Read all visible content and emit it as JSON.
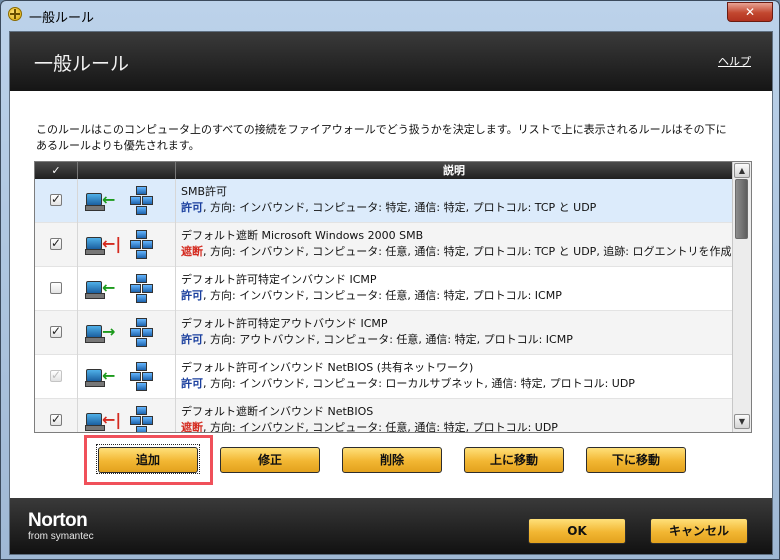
{
  "window": {
    "title": "一般ルール",
    "close_label": "✕"
  },
  "header": {
    "title": "一般ルール",
    "help_link": "ヘルプ"
  },
  "description": "このルールはこのコンピュータ上のすべての接続をファイアウォールでどう扱うかを決定します。リストで上に表示されるルールはその下にあるルールよりも優先されます。",
  "table": {
    "columns": {
      "check": "✓",
      "icon": "",
      "description": "説明"
    },
    "rows": [
      {
        "name": "SMB許可",
        "action": "許可",
        "action_color": "#1a3f9e",
        "detail": ", 方向: インバウンド, コンピュータ: 特定, 通信: 特定, プロトコル: TCP と UDP",
        "checked": true,
        "disabled": false,
        "arrow": "allow",
        "icon": "allow-inbound-icon"
      },
      {
        "name": "デフォルト遮断 Microsoft Windows 2000 SMB",
        "action": "遮断",
        "action_color": "#d42a1f",
        "detail": ", 方向: インバウンド, コンピュータ: 任意, 通信: 特定, プロトコル: TCP と UDP, 追跡: ログエントリを作成",
        "checked": true,
        "disabled": false,
        "arrow": "block",
        "icon": "block-inbound-icon"
      },
      {
        "name": "デフォルト許可特定インバウンド ICMP",
        "action": "許可",
        "action_color": "#1a3f9e",
        "detail": ", 方向: インバウンド, コンピュータ: 任意, 通信: 特定, プロトコル: ICMP",
        "checked": false,
        "disabled": false,
        "arrow": "allow",
        "icon": "allow-inbound-icon"
      },
      {
        "name": "デフォルト許可特定アウトバウンド ICMP",
        "action": "許可",
        "action_color": "#1a3f9e",
        "detail": ", 方向: アウトバウンド, コンピュータ: 任意, 通信: 特定, プロトコル: ICMP",
        "checked": true,
        "disabled": false,
        "arrow": "allow-out",
        "icon": "allow-outbound-icon"
      },
      {
        "name": "デフォルト許可インバウンド NetBIOS (共有ネットワーク)",
        "action": "許可",
        "action_color": "#1a3f9e",
        "detail": ", 方向: インバウンド, コンピュータ: ローカルサブネット, 通信: 特定, プロトコル: UDP",
        "checked": true,
        "disabled": true,
        "arrow": "allow",
        "icon": "allow-inbound-icon"
      },
      {
        "name": "デフォルト遮断インバウンド NetBIOS",
        "action": "遮断",
        "action_color": "#d42a1f",
        "detail": ", 方向: インバウンド, コンピュータ: 任意, 通信: 特定, プロトコル: UDP",
        "checked": true,
        "disabled": false,
        "arrow": "block",
        "icon": "block-inbound-icon"
      }
    ]
  },
  "buttons": {
    "add": "追加",
    "modify": "修正",
    "delete": "削除",
    "move_up": "上に移動",
    "move_down": "下に移動"
  },
  "footer": {
    "logo_main": "Norton",
    "logo_sub": "from symantec",
    "ok": "OK",
    "cancel": "キャンセル"
  },
  "colors": {
    "accent": "#f2b632",
    "highlight": "#f0505a",
    "selected_row": "#dcebfb"
  }
}
